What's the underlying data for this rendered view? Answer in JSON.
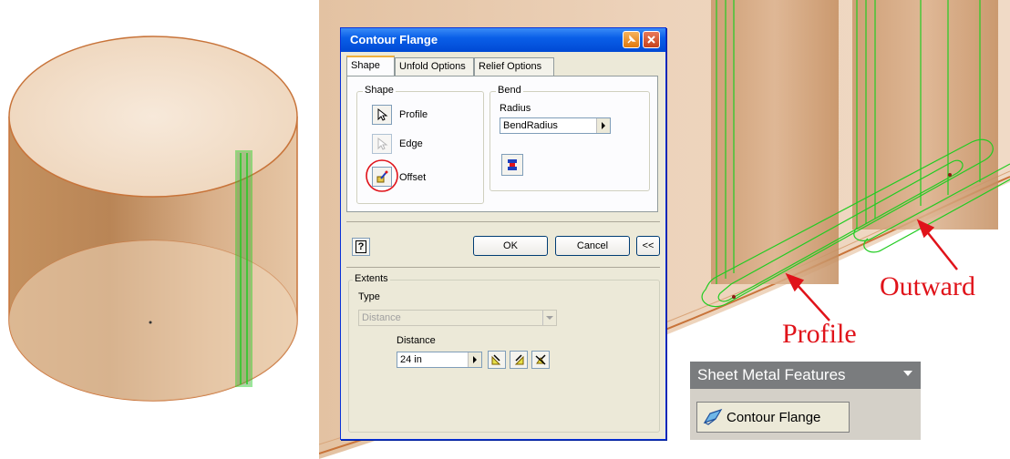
{
  "dialog": {
    "title": "Contour Flange",
    "tabs": [
      "Shape",
      "Unfold Options",
      "Relief Options"
    ],
    "shape_group": {
      "label": "Shape",
      "items": [
        {
          "label": "Profile"
        },
        {
          "label": "Edge"
        },
        {
          "label": "Offset"
        }
      ]
    },
    "bend_group": {
      "label": "Bend",
      "radius_label": "Radius",
      "radius_value": "BendRadius"
    },
    "buttons": {
      "help": "?",
      "ok": "OK",
      "cancel": "Cancel",
      "more": "<<"
    },
    "extents": {
      "label": "Extents",
      "type_label": "Type",
      "type_value": "Distance",
      "distance_label": "Distance",
      "distance_value": "24 in"
    }
  },
  "toolbar": {
    "panel_title": "Sheet Metal Features",
    "button_label": "Contour Flange"
  },
  "callouts": {
    "profile": "Profile",
    "outward": "Outward"
  },
  "colors": {
    "model_fill": "#e9c6a3",
    "model_edge": "#c8743a",
    "highlight": "#22cc22",
    "callout": "#e0131a",
    "title_blue": "#0a5fe8"
  }
}
